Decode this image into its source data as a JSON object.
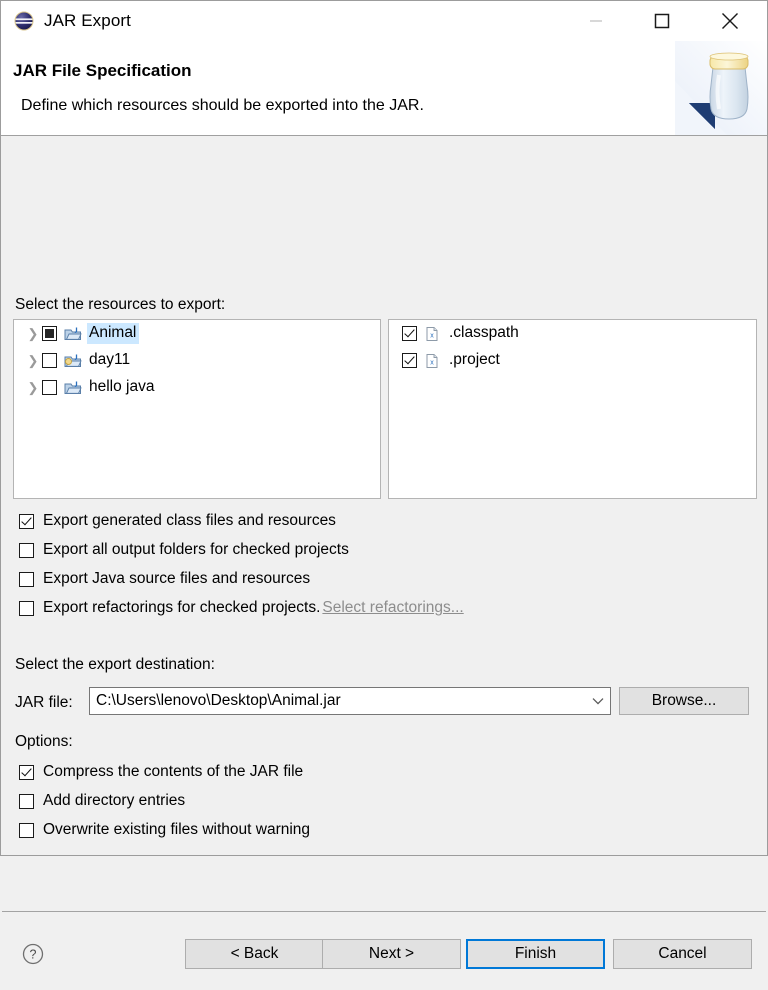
{
  "window": {
    "title": "JAR Export",
    "icon": "jar-export-icon",
    "controls": {
      "minimize": "minimize-icon",
      "maximize": "maximize-icon",
      "close": "close-icon"
    }
  },
  "header": {
    "title": "JAR File Specification",
    "description": "Define which resources should be exported into the JAR.",
    "banner_icon": "jar-banner-icon"
  },
  "resources": {
    "label": "Select the resources to export:",
    "projects": [
      {
        "name": "Animal",
        "check_state": "grayed",
        "selected": true,
        "icon": "java-project-icon",
        "expandable": true
      },
      {
        "name": "day11",
        "check_state": "unchecked",
        "selected": false,
        "icon": "java-project-icon",
        "expandable": true
      },
      {
        "name": "hello java",
        "check_state": "unchecked",
        "selected": false,
        "icon": "java-project-icon",
        "expandable": true
      }
    ],
    "files": [
      {
        "name": ".classpath",
        "check_state": "checked",
        "icon": "xml-file-icon"
      },
      {
        "name": ".project",
        "check_state": "checked",
        "icon": "xml-file-icon"
      }
    ]
  },
  "export_options": [
    {
      "label": "Export generated class files and resources",
      "check_state": "checked"
    },
    {
      "label": "Export all output folders for checked projects",
      "check_state": "unchecked"
    },
    {
      "label": "Export Java source files and resources",
      "check_state": "unchecked"
    },
    {
      "label": "Export refactorings for checked projects.",
      "check_state": "unchecked",
      "link": "Select refactorings...",
      "link_enabled": false
    }
  ],
  "destination": {
    "label": "Select the export destination:",
    "field_label": "JAR file:",
    "value": "C:\\Users\\lenovo\\Desktop\\Animal.jar",
    "browse_label": "Browse..."
  },
  "options": {
    "label": "Options:",
    "items": [
      {
        "label": "Compress the contents of the JAR file",
        "check_state": "checked"
      },
      {
        "label": "Add directory entries",
        "check_state": "unchecked"
      },
      {
        "label": "Overwrite existing files without warning",
        "check_state": "unchecked"
      }
    ]
  },
  "footer": {
    "help_icon": "help-icon",
    "buttons": [
      {
        "label": "< Back",
        "default": false
      },
      {
        "label": "Next >",
        "default": false
      },
      {
        "label": "Finish",
        "default": true
      },
      {
        "label": "Cancel",
        "default": false
      }
    ]
  },
  "colors": {
    "accent": "#0078d7",
    "selection": "#cce8ff",
    "body_bg": "#f0f0f0",
    "panel_bg": "#ffffff"
  }
}
